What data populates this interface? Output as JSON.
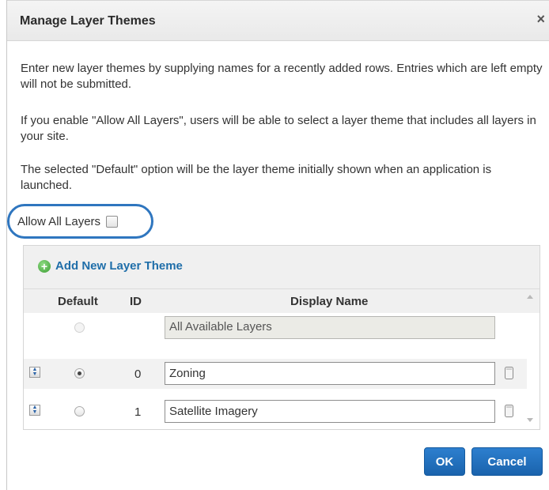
{
  "dialog": {
    "title": "Manage Layer Themes",
    "close_label": "×"
  },
  "instructions": [
    "Enter new layer themes by supplying names for a recently added rows. Entries which are left empty will not be submitted.",
    "If you enable \"Allow All Layers\", users will be able to select a layer theme that includes all layers in your site.",
    "The selected \"Default\" option will be the layer theme initially shown when an application is launched."
  ],
  "allow_all_layers": {
    "label": "Allow All Layers",
    "checked": false
  },
  "table": {
    "add_label": "Add New Layer Theme",
    "columns": {
      "default": "Default",
      "id": "ID",
      "display_name": "Display Name"
    },
    "all_layers_row": {
      "display_name": "All Available Layers"
    },
    "rows": [
      {
        "id": "0",
        "display_name": "Zoning",
        "default": true
      },
      {
        "id": "1",
        "display_name": "Satellite Imagery",
        "default": false
      }
    ]
  },
  "buttons": {
    "ok": "OK",
    "cancel": "Cancel"
  },
  "colors": {
    "accent": "#1f6ea9",
    "button": "#1a63ad",
    "highlight_ring": "#2f76bf"
  },
  "icons": {
    "close": "close-icon",
    "add": "plus-circle-icon",
    "sort": "sort-arrows-icon",
    "delete": "trash-icon"
  }
}
